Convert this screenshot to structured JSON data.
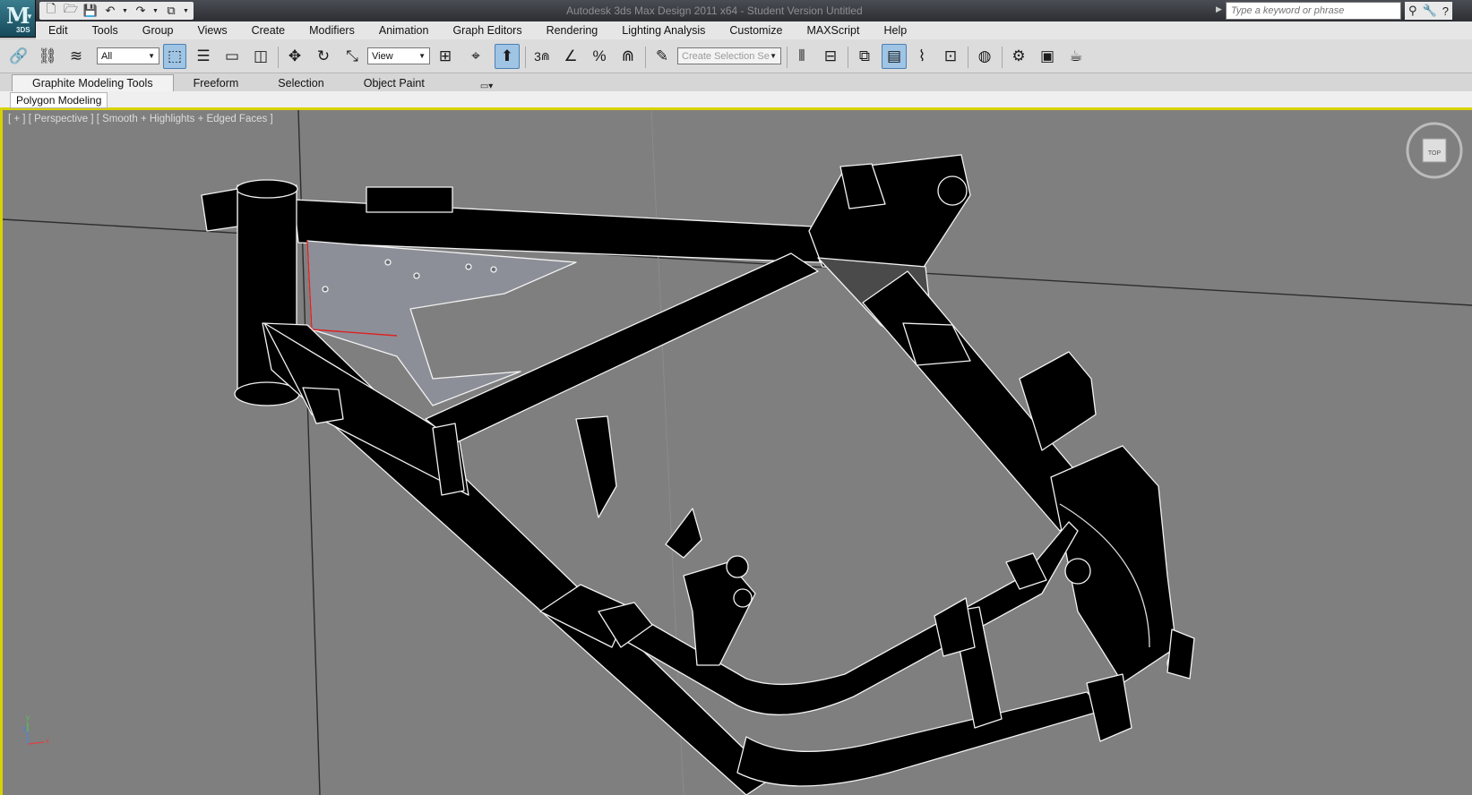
{
  "titlebar": {
    "logo": "3DS",
    "title": "Autodesk 3ds Max Design 2011 x64    - Student Version    Untitled",
    "search_placeholder": "Type a keyword or phrase",
    "quick_access_icons": [
      "new-file-icon",
      "open-file-icon",
      "save-icon",
      "undo-icon",
      "redo-icon",
      "project-folder-icon"
    ],
    "right_icons": [
      "binoculars-icon",
      "wrench-icon",
      "help-icon"
    ]
  },
  "menu": {
    "items": [
      "Edit",
      "Tools",
      "Group",
      "Views",
      "Create",
      "Modifiers",
      "Animation",
      "Graph Editors",
      "Rendering",
      "Lighting Analysis",
      "Customize",
      "MAXScript",
      "Help"
    ]
  },
  "toolbar": {
    "selection_filter": "All",
    "reference_coordinate": "View",
    "named_selection_placeholder": "Create Selection Se",
    "snap_label": "3"
  },
  "ribbon": {
    "tabs": [
      "Graphite Modeling Tools",
      "Freeform",
      "Selection",
      "Object Paint"
    ],
    "active_tab": "Graphite Modeling Tools",
    "panel": "Polygon Modeling"
  },
  "viewport": {
    "label": "[ + ] [ Perspective ] [ Smooth + Highlights + Edged Faces ]",
    "background": "#7f7f7f",
    "active_border": "#d8d300",
    "viewcube_face": "TOP",
    "axes": {
      "x": "x",
      "y": "y",
      "z": "z"
    }
  }
}
